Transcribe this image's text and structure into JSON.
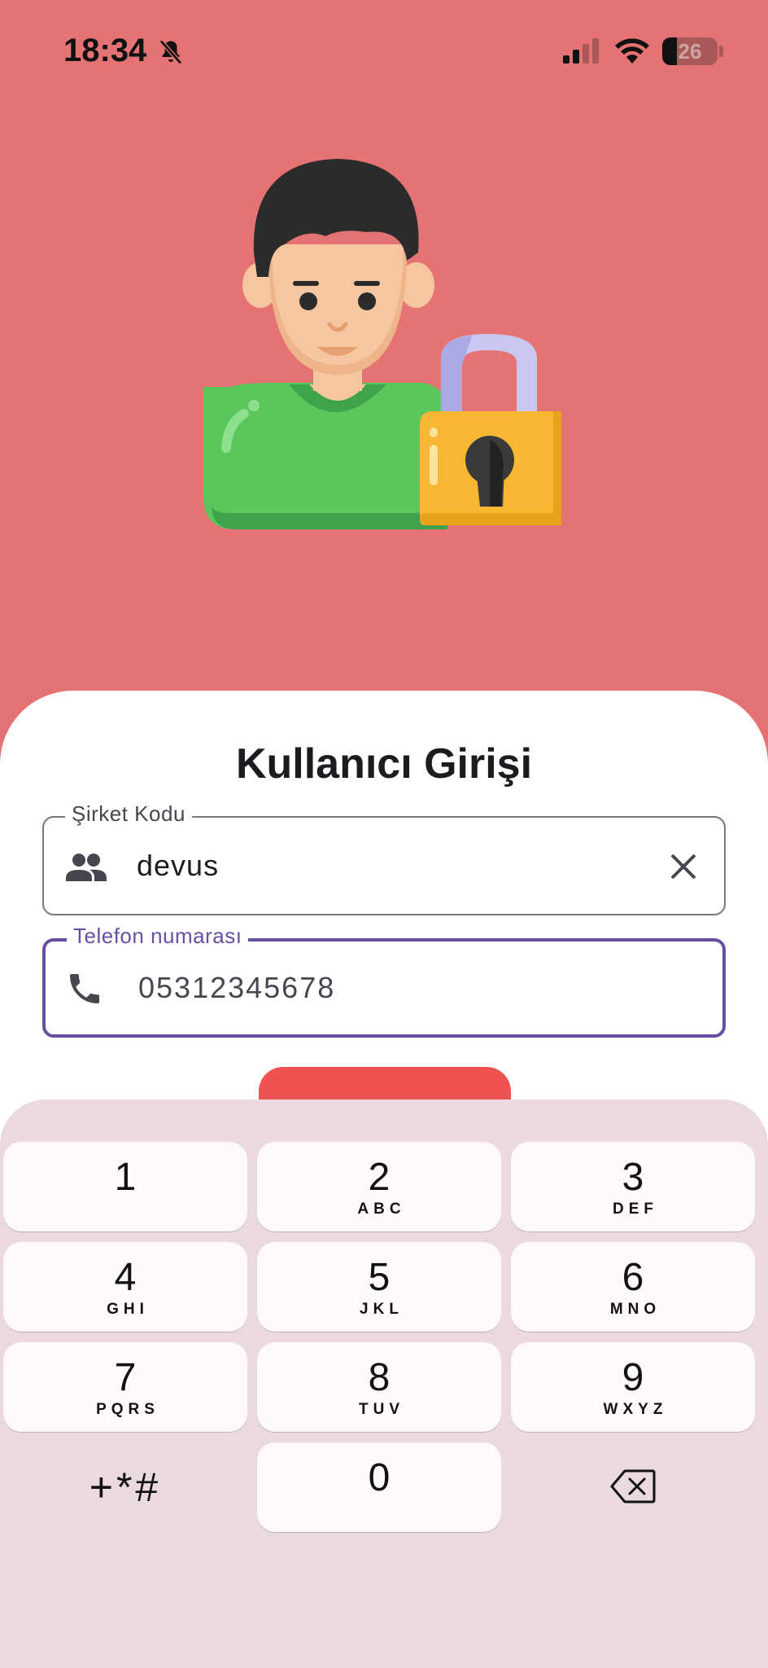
{
  "status_bar": {
    "time": "18:34",
    "battery_level": "26",
    "battery_fraction": 0.26,
    "icons": [
      "bell-slash-icon",
      "cellular-signal-icon",
      "wifi-icon",
      "battery-icon"
    ]
  },
  "illustration": {
    "description_icon": "user-with-padlock-illustration"
  },
  "login": {
    "title": "Kullanıcı Girişi",
    "company_field": {
      "label": "Şirket Kodu",
      "value": "devus",
      "icon": "people-icon",
      "clear_icon": "close-icon"
    },
    "phone_field": {
      "label": "Telefon numarası",
      "value": "05312345678",
      "icon": "phone-icon"
    }
  },
  "keypad": {
    "keys": [
      {
        "digit": "1",
        "letters": ""
      },
      {
        "digit": "2",
        "letters": "ABC"
      },
      {
        "digit": "3",
        "letters": "DEF"
      },
      {
        "digit": "4",
        "letters": "GHI"
      },
      {
        "digit": "5",
        "letters": "JKL"
      },
      {
        "digit": "6",
        "letters": "MNO"
      },
      {
        "digit": "7",
        "letters": "PQRS"
      },
      {
        "digit": "8",
        "letters": "TUV"
      },
      {
        "digit": "9",
        "letters": "WXYZ"
      },
      {
        "digit": "0",
        "letters": ""
      }
    ],
    "symbols_label": "+*#",
    "backspace_icon": "backspace-icon"
  },
  "colors": {
    "background": "#e57373",
    "accent": "#6750a4",
    "button": "#ef5350",
    "keypad_bg": "#ead9e0"
  }
}
